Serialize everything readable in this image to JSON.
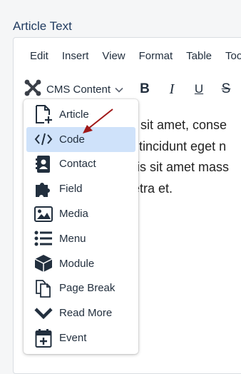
{
  "field_title": "Article Text",
  "menubar": [
    "Edit",
    "Insert",
    "View",
    "Format",
    "Table",
    "Too"
  ],
  "toolbar": {
    "cms_label": "CMS Content",
    "bold": "B",
    "italic": "I",
    "underline": "U",
    "strike": "S"
  },
  "content_lines": [
    "r sit amet, conse",
    "l tincidunt eget n",
    "ris sit amet mass",
    "etra et."
  ],
  "dropdown": {
    "items": [
      {
        "label": "Article",
        "icon": "article-add-icon"
      },
      {
        "label": "Code",
        "icon": "code-icon"
      },
      {
        "label": "Contact",
        "icon": "contact-card-icon"
      },
      {
        "label": "Field",
        "icon": "puzzle-icon"
      },
      {
        "label": "Media",
        "icon": "image-icon"
      },
      {
        "label": "Menu",
        "icon": "list-icon"
      },
      {
        "label": "Module",
        "icon": "cube-icon"
      },
      {
        "label": "Page Break",
        "icon": "copy-icon"
      },
      {
        "label": "Read More",
        "icon": "chevron-down-icon"
      },
      {
        "label": "Event",
        "icon": "calendar-plus-icon"
      }
    ],
    "active_item": "Code"
  },
  "colors": {
    "accent_highlight": "#cfe2fa",
    "title_color": "#1f3a5f",
    "arrow_color": "#a01818"
  }
}
